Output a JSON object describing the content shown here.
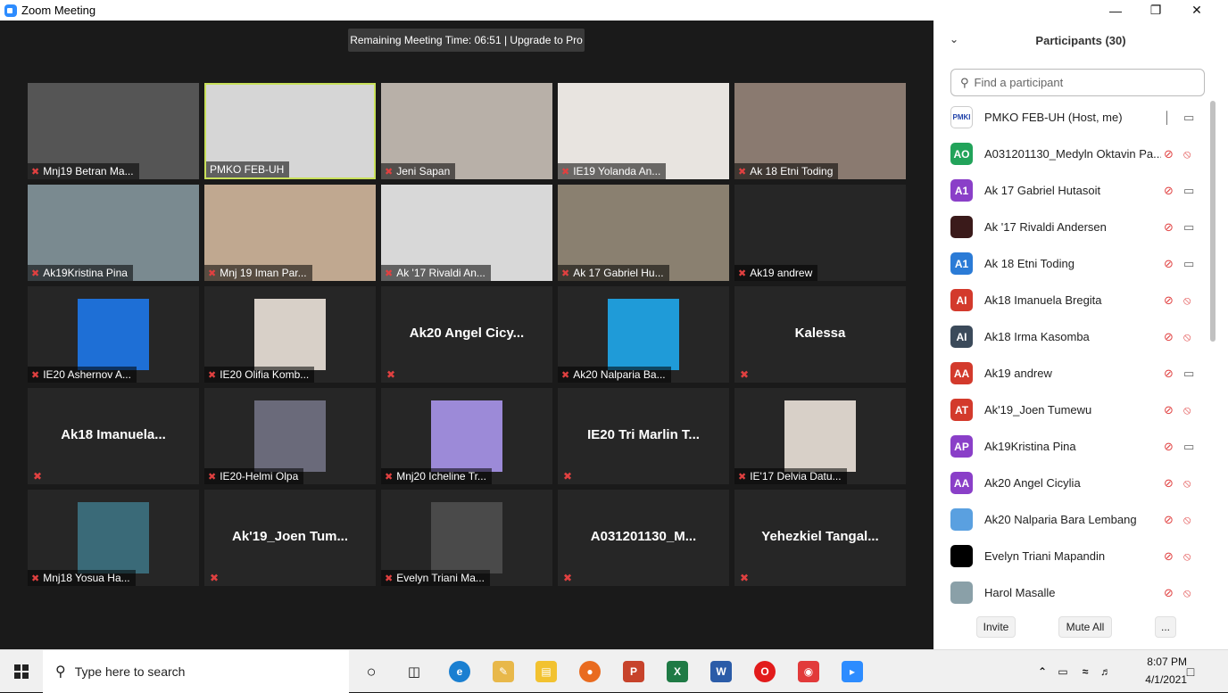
{
  "window": {
    "title": "Zoom Meeting"
  },
  "meeting": {
    "timer_text": "Remaining Meeting Time: 06:51 | Upgrade to Pro",
    "tiles": [
      {
        "name": "Mnj19 Betran Ma...",
        "kind": "video"
      },
      {
        "name": "PMKO FEB-UH",
        "kind": "video",
        "active": true
      },
      {
        "name": "Jeni Sapan",
        "kind": "video"
      },
      {
        "name": "IE19 Yolanda An...",
        "kind": "video"
      },
      {
        "name": "Ak 18 Etni Toding",
        "kind": "video"
      },
      {
        "name": "Ak19Kristina Pina",
        "kind": "video"
      },
      {
        "name": "Mnj 19 Iman Par...",
        "kind": "video"
      },
      {
        "name": "Ak '17 Rivaldi An...",
        "kind": "video"
      },
      {
        "name": "Ak 17 Gabriel Hu...",
        "kind": "video"
      },
      {
        "name": "Ak19 andrew",
        "kind": "blank"
      },
      {
        "name": "IE20 Ashernov A...",
        "kind": "photo"
      },
      {
        "name": "IE20 Olifia Komb...",
        "kind": "photo"
      },
      {
        "name": "Ak20  Angel Cicy...",
        "kind": "text"
      },
      {
        "name": "Ak20 Nalparia Ba...",
        "kind": "photo"
      },
      {
        "name": "Kalessa",
        "kind": "text"
      },
      {
        "name": "Ak18  Imanuela...",
        "kind": "text"
      },
      {
        "name": "IE20-Helmi Olpa",
        "kind": "photo"
      },
      {
        "name": "Mnj20 Icheline Tr...",
        "kind": "photo"
      },
      {
        "name": "IE20 Tri Marlin T...",
        "kind": "text"
      },
      {
        "name": "IE'17 Delvia Datu...",
        "kind": "photo"
      },
      {
        "name": "Mnj18 Yosua Ha...",
        "kind": "photo"
      },
      {
        "name": "Ak'19_Joen  Tum...",
        "kind": "text"
      },
      {
        "name": "Evelyn Triani Ma...",
        "kind": "photo"
      },
      {
        "name": "A031201130_M...",
        "kind": "text"
      },
      {
        "name": "Yehezkiel  Tangal...",
        "kind": "text"
      }
    ]
  },
  "panel": {
    "title": "Participants (30)",
    "search_placeholder": "Find a participant",
    "participants": [
      {
        "avatar": "",
        "color": "#ffffff",
        "name": "PMKO FEB-UH (Host, me)",
        "mic": "on",
        "cam": "on",
        "logo": true
      },
      {
        "avatar": "AO",
        "color": "#22a35a",
        "name": "A031201130_Medyln Oktavin Pa...",
        "mic": "off",
        "cam": "off"
      },
      {
        "avatar": "A1",
        "color": "#8a3fc8",
        "name": "Ak 17 Gabriel Hutasoit",
        "mic": "off",
        "cam": "on"
      },
      {
        "avatar": "",
        "color": "#3a1a1a",
        "name": "Ak '17 Rivaldi Andersen",
        "mic": "off",
        "cam": "on"
      },
      {
        "avatar": "A1",
        "color": "#2b7bd6",
        "name": "Ak 18 Etni Toding",
        "mic": "off",
        "cam": "on"
      },
      {
        "avatar": "AI",
        "color": "#d33a2c",
        "name": "Ak18 Imanuela Bregita",
        "mic": "off",
        "cam": "off"
      },
      {
        "avatar": "AI",
        "color": "#3b4a5a",
        "name": "Ak18 Irma Kasomba",
        "mic": "off",
        "cam": "off"
      },
      {
        "avatar": "AA",
        "color": "#d33a2c",
        "name": "Ak19 andrew",
        "mic": "off",
        "cam": "on"
      },
      {
        "avatar": "AT",
        "color": "#d33a2c",
        "name": "Ak'19_Joen Tumewu",
        "mic": "off",
        "cam": "off"
      },
      {
        "avatar": "AP",
        "color": "#8a3fc8",
        "name": "Ak19Kristina Pina",
        "mic": "off",
        "cam": "on"
      },
      {
        "avatar": "AA",
        "color": "#8a3fc8",
        "name": "Ak20 Angel Cicylia",
        "mic": "off",
        "cam": "off"
      },
      {
        "avatar": "",
        "color": "#5aa0e0",
        "name": "Ak20 Nalparia Bara Lembang",
        "mic": "off",
        "cam": "off"
      },
      {
        "avatar": "",
        "color": "#000000",
        "name": "Evelyn Triani Mapandin",
        "mic": "off",
        "cam": "off"
      },
      {
        "avatar": "",
        "color": "#8aa0a8",
        "name": "Harol Masalle",
        "mic": "off",
        "cam": "off"
      }
    ],
    "invite_label": "Invite",
    "mute_all_label": "Mute All",
    "more_label": "..."
  },
  "taskbar": {
    "search_placeholder": "Type here to search",
    "time": "8:07 PM",
    "date": "4/1/2021"
  }
}
